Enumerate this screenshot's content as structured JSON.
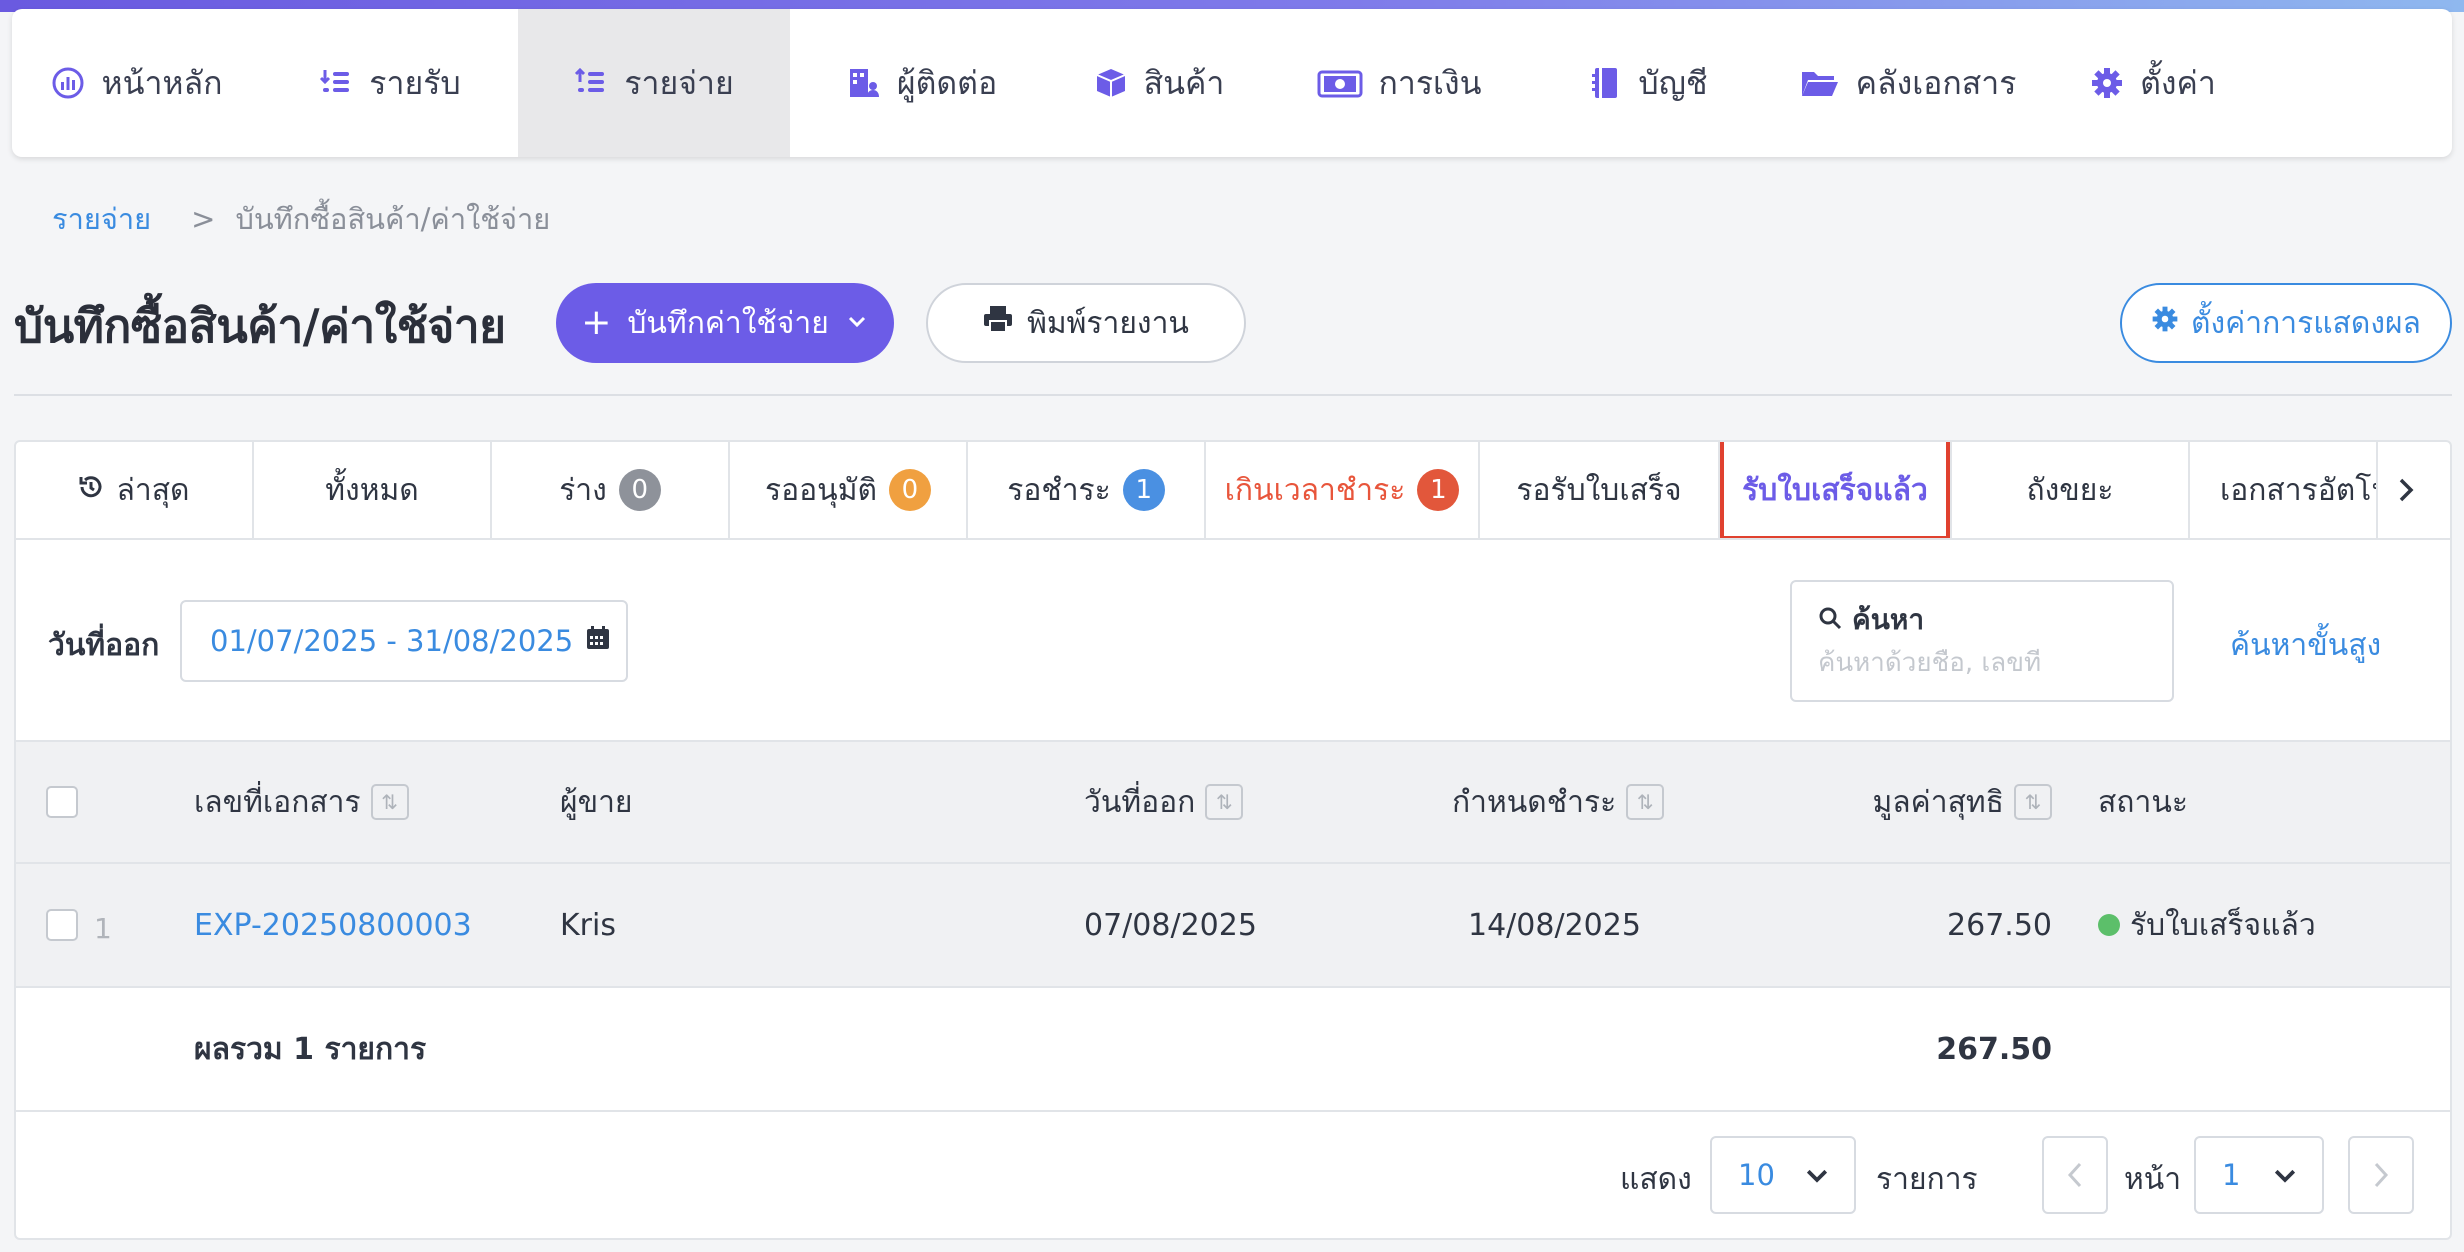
{
  "colors": {
    "accent": "#6c5ce7",
    "link": "#3a8be0",
    "overdue": "#e8553b",
    "badge_gray": "#8e929a",
    "badge_orange": "#f0a040",
    "badge_blue": "#4a90e2",
    "badge_red": "#e2573b",
    "status_green": "#5cbf6a"
  },
  "nav": [
    {
      "label": "หน้าหลัก",
      "icon": "dashboard-icon"
    },
    {
      "label": "รายรับ",
      "icon": "income-icon"
    },
    {
      "label": "รายจ่าย",
      "icon": "expense-icon",
      "active": true
    },
    {
      "label": "ผู้ติดต่อ",
      "icon": "contacts-icon"
    },
    {
      "label": "สินค้า",
      "icon": "box-icon"
    },
    {
      "label": "การเงิน",
      "icon": "money-icon"
    },
    {
      "label": "บัญชี",
      "icon": "ledger-icon"
    },
    {
      "label": "คลังเอกสาร",
      "icon": "folder-icon"
    },
    {
      "label": "ตั้งค่า",
      "icon": "gear-icon"
    }
  ],
  "breadcrumb": {
    "root": "รายจ่าย",
    "separator": ">",
    "current": "บันทึกซื้อสินค้า/ค่าใช้จ่าย"
  },
  "header": {
    "title": "บันทึกซื้อสินค้า/ค่าใช้จ่าย",
    "add_button": "บันทึกค่าใช้จ่าย",
    "print_button": "พิมพ์รายงาน",
    "settings_button": "ตั้งค่าการแสดงผล"
  },
  "tabs": [
    {
      "label": "ล่าสุด",
      "icon": "history-icon"
    },
    {
      "label": "ทั้งหมด"
    },
    {
      "label": "ร่าง",
      "badge": "0"
    },
    {
      "label": "รออนุมัติ",
      "badge": "0"
    },
    {
      "label": "รอชำระ",
      "badge": "1"
    },
    {
      "label": "เกินเวลาชำระ",
      "badge": "1"
    },
    {
      "label": "รอรับใบเสร็จ"
    },
    {
      "label": "รับใบเสร็จแล้ว",
      "active": true
    },
    {
      "label": "ถังขยะ"
    },
    {
      "label": "เอกสารอัตโนมัติ"
    }
  ],
  "filters": {
    "date_label": "วันที่ออก",
    "date_range": "01/07/2025 - 31/08/2025",
    "search_label": "ค้นหา",
    "search_placeholder": "ค้นหาด้วยชื่อ, เลขที่",
    "advanced_search": "ค้นหาขั้นสูง"
  },
  "table": {
    "columns": [
      "เลขที่เอกสาร",
      "ผู้ขาย",
      "วันที่ออก",
      "กำหนดชำระ",
      "มูลค่าสุทธิ",
      "สถานะ"
    ],
    "rows": [
      {
        "index": "1",
        "doc_no": "EXP-20250800003",
        "vendor": "Kris",
        "issue_date": "07/08/2025",
        "due_date": "14/08/2025",
        "net_amount": "267.50",
        "status": "รับใบเสร็จแล้ว"
      }
    ],
    "footer_label": "ผลรวม 1 รายการ",
    "footer_total": "267.50"
  },
  "pagination": {
    "show_label": "แสดง",
    "page_size": "10",
    "items_label": "รายการ",
    "page_label": "หน้า",
    "page": "1"
  }
}
